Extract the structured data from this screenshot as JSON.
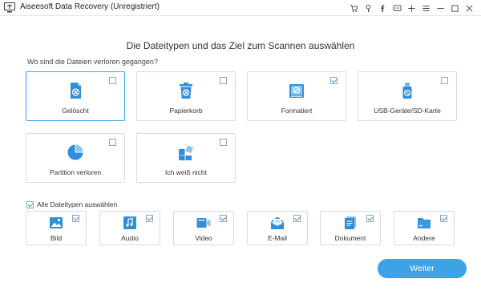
{
  "window": {
    "title": "Aiseesoft Data Recovery (Unregistriert)",
    "titlebar_icons": [
      "cart-icon",
      "key-icon",
      "facebook-icon",
      "chat-icon",
      "plus-icon",
      "menu-icon",
      "minimize-icon",
      "maximize-icon",
      "close-icon"
    ]
  },
  "heading": "Die Dateitypen und das Ziel zum Scannen auswählen",
  "question": "Wo sind die Dateien verloren gegangen?",
  "locations": [
    {
      "label": "Gelöscht",
      "checked": false,
      "selected": true,
      "icon": "deleted-icon"
    },
    {
      "label": "Papierkorb",
      "checked": false,
      "selected": false,
      "icon": "trash-icon"
    },
    {
      "label": "Formatiert",
      "checked": true,
      "selected": false,
      "icon": "formatted-icon"
    },
    {
      "label": "USB-Geräte/SD-Karte",
      "checked": false,
      "selected": false,
      "icon": "usb-icon"
    },
    {
      "label": "Partition verloren",
      "checked": false,
      "selected": false,
      "icon": "partition-icon"
    },
    {
      "label": "Ich weiß nicht",
      "checked": false,
      "selected": false,
      "icon": "unknown-icon"
    }
  ],
  "all_types": {
    "label": "Alle Dateitypen auswählen",
    "checked": true
  },
  "file_types": [
    {
      "label": "Bild",
      "checked": true,
      "icon": "image-icon"
    },
    {
      "label": "Audio",
      "checked": true,
      "icon": "audio-icon"
    },
    {
      "label": "Video",
      "checked": true,
      "icon": "video-icon"
    },
    {
      "label": "E-Mail",
      "checked": true,
      "icon": "email-icon"
    },
    {
      "label": "Dokument",
      "checked": true,
      "icon": "document-icon"
    },
    {
      "label": "Andere",
      "checked": true,
      "icon": "other-icon"
    }
  ],
  "next_button": "Weiter",
  "colors": {
    "accent": "#3ea2e6",
    "icon_blue": "#2f8fd8",
    "border": "#d7dbe0"
  }
}
